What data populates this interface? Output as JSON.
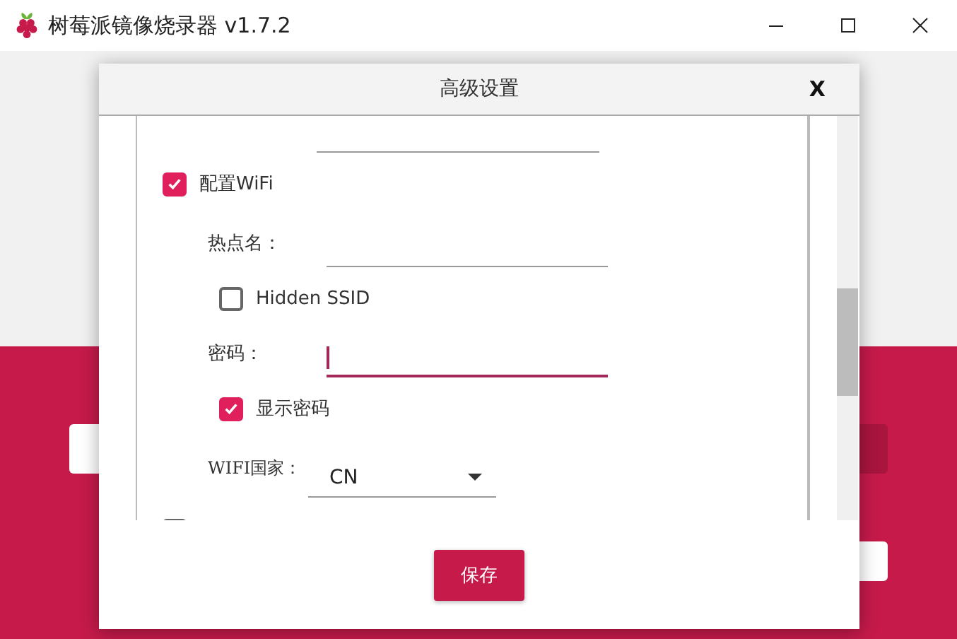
{
  "window": {
    "title": "树莓派镜像烧录器 v1.7.2"
  },
  "dialog": {
    "title": "高级设置",
    "close": "X",
    "items": [
      {
        "kind": "field",
        "focused": false
      },
      {
        "kind": "checkbox",
        "label": "配置WiFi",
        "checked": true,
        "children": [
          {
            "kind": "field",
            "label": "热点名：",
            "focused": false
          },
          {
            "kind": "checkbox",
            "label": "Hidden SSID",
            "checked": false
          },
          {
            "kind": "field",
            "label": "密码：",
            "focused": true
          },
          {
            "kind": "checkbox",
            "label": "显示密码",
            "checked": true
          },
          {
            "kind": "select",
            "label": "WIFI国家：",
            "value": "CN"
          }
        ]
      },
      {
        "kind": "checkbox",
        "checked": false
      }
    ],
    "save_button": "保存"
  }
}
